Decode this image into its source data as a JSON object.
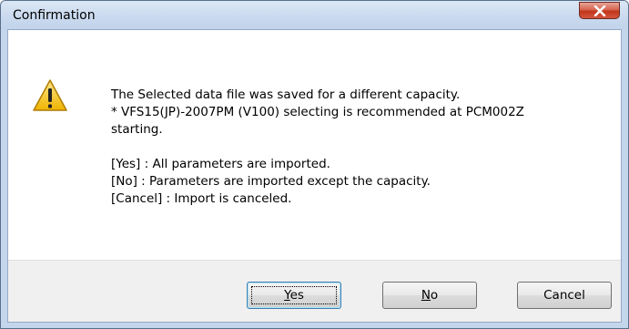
{
  "window": {
    "title": "Confirmation",
    "close_icon": "close-icon"
  },
  "icon": "warning-icon",
  "message": {
    "lines": [
      "The Selected data file was saved for a different capacity.",
      "* VFS15(JP)-2007PM (V100) selecting is recommended at PCM002Z",
      "starting.",
      "[Yes] : All parameters are imported.",
      "[No] : Parameters are imported except the capacity.",
      "[Cancel] : Import is canceled."
    ]
  },
  "buttons": {
    "yes": {
      "mnemonic": "Y",
      "rest": "es"
    },
    "no": {
      "mnemonic": "N",
      "rest": "o"
    },
    "cancel": {
      "label": "Cancel"
    }
  },
  "colors": {
    "title_bar": "#c9d9ee",
    "close_button": "#c1351a",
    "footer": "#f0f0f0",
    "warning": "#f5c21b"
  }
}
